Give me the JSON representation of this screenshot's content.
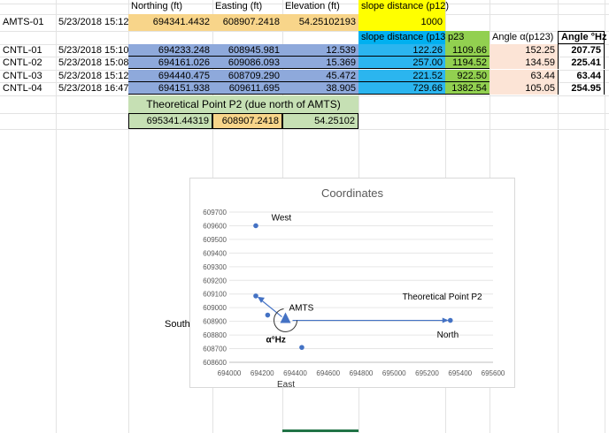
{
  "colors": {
    "orange": "#f8d58a",
    "blue_header": "#00b0f0",
    "green": "#92d050",
    "yellow": "#ffff00",
    "light_orange": "#fce4d6",
    "light_green": "#c6e0b4",
    "purple_blue": "#8ea9db",
    "cyan": "#2bb5ef"
  },
  "headers": {
    "northing": "Northing (ft)",
    "easting": "Easting (ft)",
    "elevation": "Elevation (ft)",
    "slope_p12": "slope distance (p12)",
    "slope_p13": "slope distance (p13",
    "p23": "p23",
    "angle_alpha": "Angle α(p123)",
    "angle_hz": "Angle °Hz"
  },
  "amts": {
    "name": "AMTS-01",
    "date": "5/23/2018 15:12",
    "northing": "694341.4432",
    "easting": "608907.2418",
    "elevation": "54.25102193",
    "slope": "1000"
  },
  "rows": [
    {
      "name": "CNTL-01",
      "date": "5/23/2018 15:10",
      "northing": "694233.248",
      "easting": "608945.981",
      "elevation": "12.539",
      "p13": "122.26",
      "p23": "1109.66",
      "alpha": "152.25",
      "hz": "207.75"
    },
    {
      "name": "CNTL-02",
      "date": "5/23/2018 15:08",
      "northing": "694161.026",
      "easting": "609086.093",
      "elevation": "15.369",
      "p13": "257.00",
      "p23": "1194.52",
      "alpha": "134.59",
      "hz": "225.41"
    },
    {
      "name": "CNTL-03",
      "date": "5/23/2018 15:12",
      "northing": "694440.475",
      "easting": "608709.290",
      "elevation": "45.472",
      "p13": "221.52",
      "p23": "922.50",
      "alpha": "63.44",
      "hz": "63.44"
    },
    {
      "name": "CNTL-04",
      "date": "5/23/2018 16:47",
      "northing": "694151.938",
      "easting": "609611.695",
      "elevation": "38.905",
      "p13": "729.66",
      "p23": "1382.54",
      "alpha": "105.05",
      "hz": "254.95"
    }
  ],
  "theoretical": {
    "title": "Theoretical Point P2 (due north of AMTS)",
    "northing": "695341.44319",
    "easting": "608907.2418",
    "elevation": "54.25102"
  },
  "chart_data": {
    "type": "scatter",
    "title": "Coordinates",
    "xlabel": "East",
    "ylabel": "",
    "xlim": [
      694000,
      695600
    ],
    "ylim": [
      608600,
      609700
    ],
    "xticks": [
      "694000",
      "694200",
      "694400",
      "694600",
      "694800",
      "695000",
      "695200",
      "695400",
      "695600"
    ],
    "yticks": [
      "609700",
      "609600",
      "609500",
      "609400",
      "609300",
      "609200",
      "609100",
      "609000",
      "608900",
      "608800",
      "608700",
      "608600"
    ],
    "points": [
      {
        "x": 694161,
        "y": 609600
      },
      {
        "x": 694161,
        "y": 609086
      },
      {
        "x": 694233,
        "y": 608946
      },
      {
        "x": 694440,
        "y": 608709
      },
      {
        "x": 695341,
        "y": 608907
      }
    ],
    "amts_point": {
      "x": 694341,
      "y": 608907
    },
    "annotations": {
      "west": "West",
      "south": "South",
      "north": "North",
      "amts": "AMTS",
      "theoretical": "Theoretical Point P2",
      "angle": "α°Hz"
    }
  }
}
